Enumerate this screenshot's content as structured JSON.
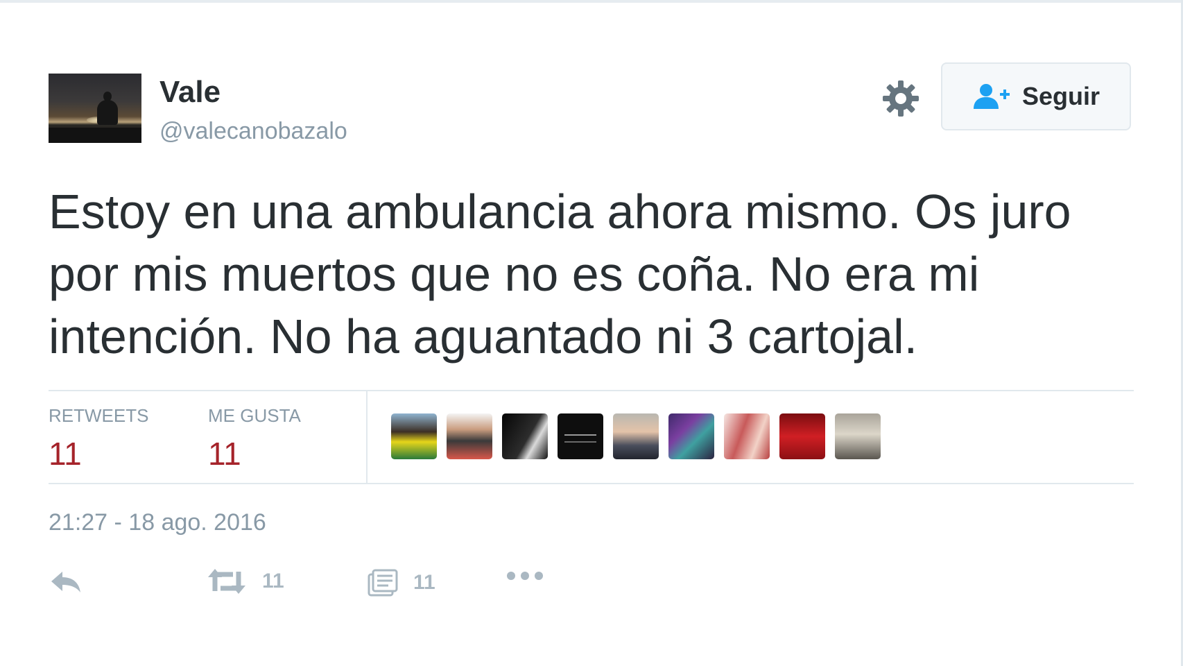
{
  "user": {
    "name": "Vale",
    "handle": "@valecanobazalo"
  },
  "follow_button": {
    "label": "Seguir"
  },
  "tweet": {
    "text": "Estoy en una ambulancia ahora mismo. Os juro por mis muertos que no es coña. No era mi intención. No ha aguantado ni 3 cartojal.",
    "timestamp": "21:27 - 18 ago. 2016"
  },
  "stats": {
    "retweets_label": "RETWEETS",
    "retweets_count": "11",
    "likes_label": "ME GUSTA",
    "likes_count": "11"
  },
  "actions": {
    "retweet_count": "11",
    "like_count": "11"
  },
  "icons": [
    "gear-icon",
    "follow-person-plus-icon",
    "reply-icon",
    "retweet-icon",
    "like-icon",
    "more-icon"
  ],
  "colors": {
    "count_red": "#a5232a",
    "follow_icon_blue": "#1da1f2",
    "muted_gray": "#8899a6",
    "action_gray": "#aab8c2"
  }
}
